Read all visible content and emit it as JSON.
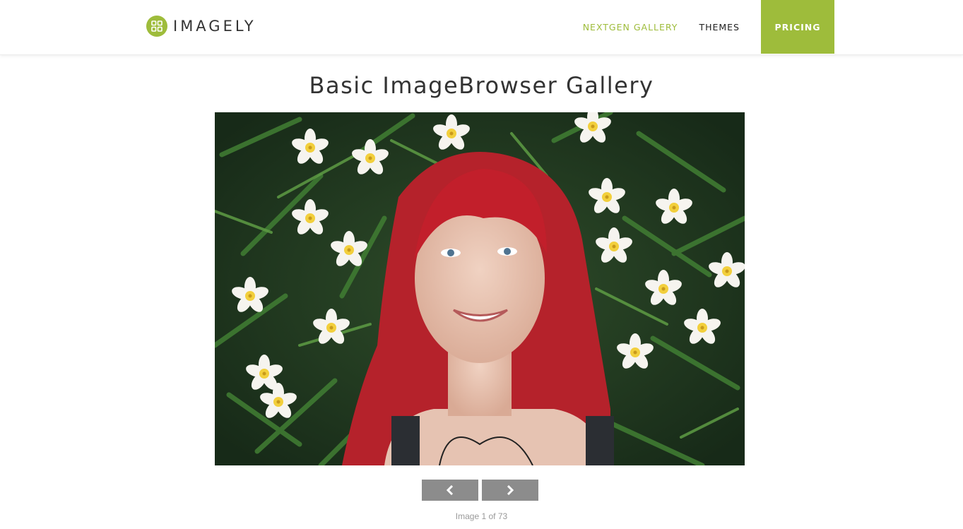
{
  "brand": {
    "name": "IMAGELY",
    "logo_icon": "grid-logo-icon",
    "accent_color": "#9ebc3b"
  },
  "nav": {
    "items": [
      {
        "label": "NEXTGEN GALLERY",
        "active": true
      },
      {
        "label": "THEMES",
        "active": false
      }
    ],
    "cta_label": "PRICING"
  },
  "page": {
    "title": "Basic ImageBrowser Gallery"
  },
  "gallery": {
    "prev_icon": "chevron-left-icon",
    "next_icon": "chevron-right-icon",
    "counter_text": "Image 1 of 73"
  }
}
